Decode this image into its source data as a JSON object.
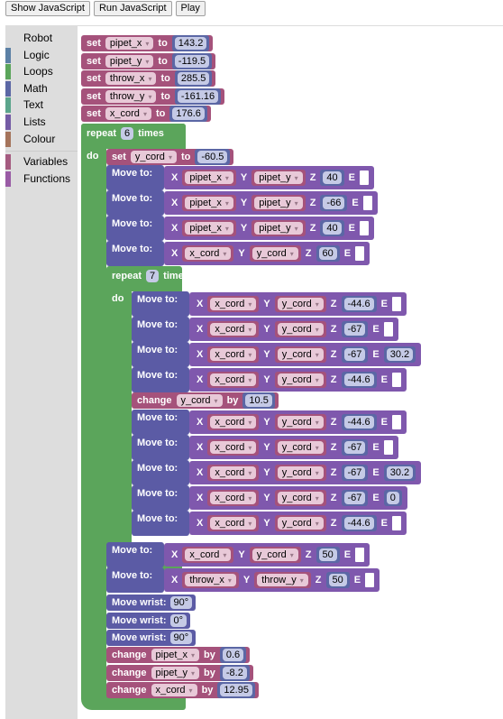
{
  "toolbar": {
    "show_js_label": "Show JavaScript",
    "run_js_label": "Run JavaScript",
    "play_label": "Play"
  },
  "toolbox": {
    "categories": [
      {
        "label": "Robot",
        "color": ""
      },
      {
        "label": "Logic",
        "color": "#5b80a5"
      },
      {
        "label": "Loops",
        "color": "#5ba55b"
      },
      {
        "label": "Math",
        "color": "#5b67a5"
      },
      {
        "label": "Text",
        "color": "#5ba58c"
      },
      {
        "label": "Lists",
        "color": "#745ba5"
      },
      {
        "label": "Colour",
        "color": "#a5745b"
      },
      {
        "label": "Variables",
        "color": "#a55b80"
      },
      {
        "label": "Functions",
        "color": "#995ba5"
      }
    ]
  },
  "kw": {
    "set": "set",
    "to": "to",
    "repeat": "repeat",
    "times": "times",
    "do": "do",
    "move_to": "Move to:",
    "x": "X",
    "y": "Y",
    "z": "Z",
    "e": "E",
    "change": "change",
    "by": "by",
    "move_wrist": "Move wrist:"
  },
  "program": {
    "sets": [
      {
        "var": "pipet_x",
        "value": "143.2"
      },
      {
        "var": "pipet_y",
        "value": "-119.5"
      },
      {
        "var": "throw_x",
        "value": "285.5"
      },
      {
        "var": "throw_y",
        "value": "-161.16"
      },
      {
        "var": "x_cord",
        "value": "176.6"
      }
    ],
    "outer_repeat": "6",
    "set_y": {
      "var": "y_cord",
      "value": "-60.5"
    },
    "moves_a": [
      {
        "x": "pipet_x",
        "y": "pipet_y",
        "z": "40",
        "e": ""
      },
      {
        "x": "pipet_x",
        "y": "pipet_y",
        "z": "-66",
        "e": ""
      },
      {
        "x": "pipet_x",
        "y": "pipet_y",
        "z": "40",
        "e": ""
      },
      {
        "x": "x_cord",
        "y": "y_cord",
        "z": "60",
        "e": ""
      }
    ],
    "inner_repeat": "7",
    "moves_b": [
      {
        "x": "x_cord",
        "y": "y_cord",
        "z": "-44.6",
        "e": ""
      },
      {
        "x": "x_cord",
        "y": "y_cord",
        "z": "-67",
        "e": ""
      },
      {
        "x": "x_cord",
        "y": "y_cord",
        "z": "-67",
        "e": "30.2"
      },
      {
        "x": "x_cord",
        "y": "y_cord",
        "z": "-44.6",
        "e": ""
      }
    ],
    "change_y": {
      "var": "y_cord",
      "value": "10.5"
    },
    "moves_c": [
      {
        "x": "x_cord",
        "y": "y_cord",
        "z": "-44.6",
        "e": ""
      },
      {
        "x": "x_cord",
        "y": "y_cord",
        "z": "-67",
        "e": ""
      },
      {
        "x": "x_cord",
        "y": "y_cord",
        "z": "-67",
        "e": "30.2"
      },
      {
        "x": "x_cord",
        "y": "y_cord",
        "z": "-67",
        "e": "0"
      },
      {
        "x": "x_cord",
        "y": "y_cord",
        "z": "-44.6",
        "e": ""
      }
    ],
    "moves_d": [
      {
        "x": "x_cord",
        "y": "y_cord",
        "z": "50",
        "e": ""
      },
      {
        "x": "throw_x",
        "y": "throw_y",
        "z": "50",
        "e": ""
      }
    ],
    "wrists": [
      "90°",
      "0°",
      "90°"
    ],
    "changes": [
      {
        "var": "pipet_x",
        "value": "0.6"
      },
      {
        "var": "pipet_y",
        "value": "-8.2"
      },
      {
        "var": "x_cord",
        "value": "12.95"
      }
    ]
  }
}
